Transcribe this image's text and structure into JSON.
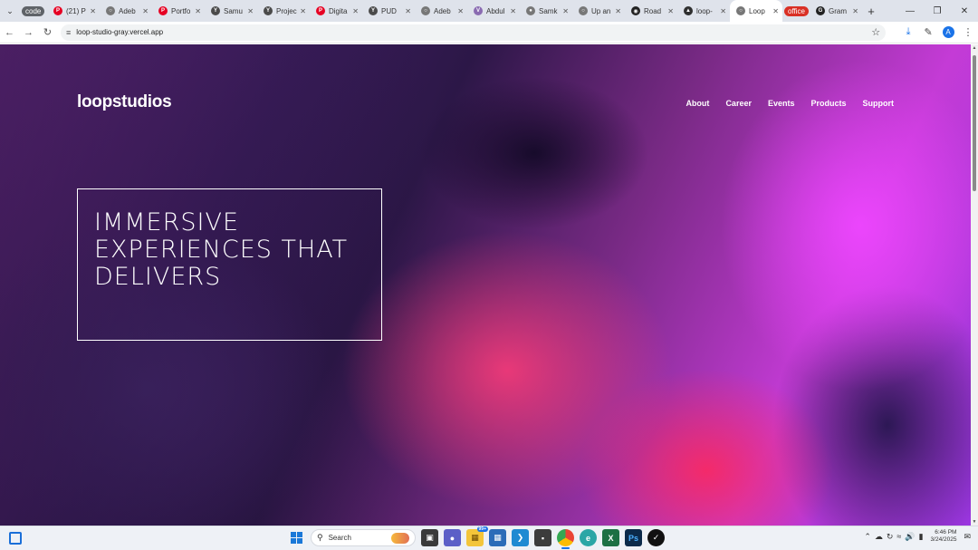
{
  "browser": {
    "tabs": [
      {
        "type": "group",
        "label": "code",
        "color": "#5f6368"
      },
      {
        "label": "(21) P",
        "icon": "pinterest-icon"
      },
      {
        "label": "Adeb",
        "icon": "globe-icon"
      },
      {
        "label": "Portfo",
        "icon": "pinterest-icon"
      },
      {
        "label": "Samu",
        "icon": "yt-icon"
      },
      {
        "label": "Projec",
        "icon": "yt-icon"
      },
      {
        "label": "Digita",
        "icon": "pinterest-icon"
      },
      {
        "label": "PUD",
        "icon": "yt-icon"
      },
      {
        "label": "Adeb",
        "icon": "globe-icon"
      },
      {
        "label": "Abdul",
        "icon": "v-icon"
      },
      {
        "label": "Samk",
        "icon": "avatar-icon"
      },
      {
        "label": "Up an",
        "icon": "globe-icon"
      },
      {
        "label": "Road",
        "icon": "github-icon"
      },
      {
        "label": "loop-",
        "icon": "loop-icon"
      },
      {
        "label": "Loop",
        "icon": "globe-icon",
        "active": true
      },
      {
        "type": "group",
        "label": "office",
        "color": "#d93025"
      },
      {
        "label": "Gram",
        "icon": "grammarly-icon"
      }
    ],
    "url": "loop-studio-gray.vercel.app"
  },
  "site": {
    "logo": "loopstudios",
    "nav": [
      "About",
      "Career",
      "Events",
      "Products",
      "Support"
    ],
    "hero_title": "IMMERSIVE EXPERIENCES THAT DELIVERS"
  },
  "taskbar": {
    "search_label": "Search",
    "badge": "99+",
    "time": "6:46 PM",
    "date": "3/24/2025"
  },
  "colors": {
    "accent": "#1a73e8",
    "hero_magenta": "#c43bd6",
    "hero_dark": "#2c1747"
  }
}
